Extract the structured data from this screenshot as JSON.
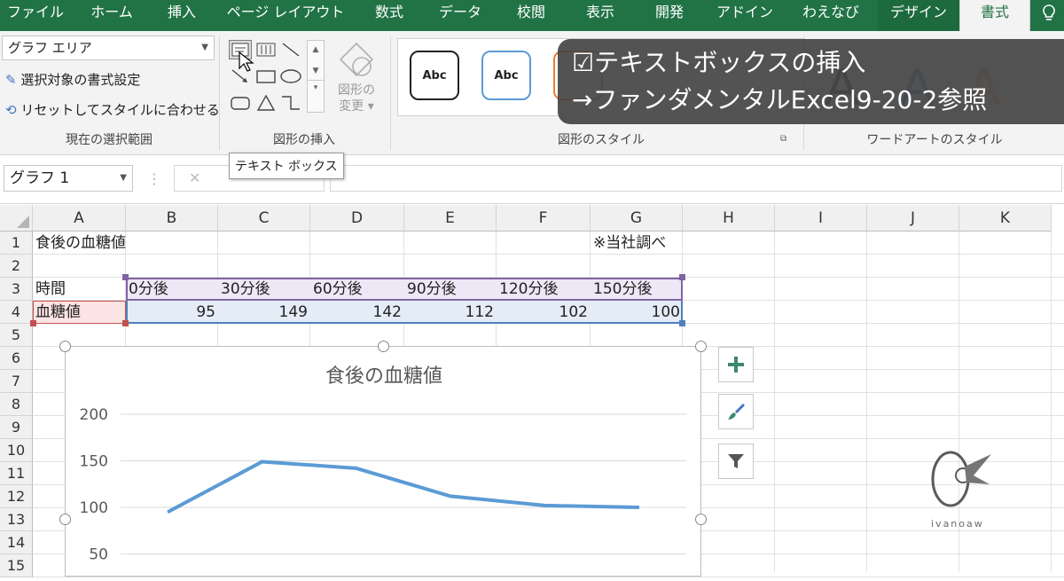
{
  "tabs": [
    "ファイル",
    "ホーム",
    "挿入",
    "ページ レイアウト",
    "数式",
    "データ",
    "校閲",
    "表示",
    "開発",
    "アドイン",
    "わえなび",
    "デザイン",
    "書式"
  ],
  "tab_lightbulb_icon": "lightbulb-icon",
  "ribbon": {
    "selection_combo": "グラフ エリア",
    "format_selection": "選択対象の書式設定",
    "reset_style": "リセットしてスタイルに合わせる",
    "group_current_selection": "現在の選択範囲",
    "change_shape_line1": "図形の",
    "change_shape_line2": "変更",
    "group_insert_shapes": "図形の挿入",
    "shape_style_abc1": "Abc",
    "shape_style_abc2": "Abc",
    "group_shape_styles": "図形のスタイル",
    "group_wordart_styles": "ワードアートのスタイル",
    "tooltip": "テキスト ボックス"
  },
  "formula_bar": {
    "name_box": "グラフ 1",
    "cancel_symbol": "✕"
  },
  "caption": {
    "line1": "☑テキストボックスの挿入",
    "line2": "→ファンダメンタルExcel9-20-2参照"
  },
  "columns": [
    "A",
    "B",
    "C",
    "D",
    "E",
    "F",
    "G",
    "H",
    "I",
    "J",
    "K"
  ],
  "rows": [
    "1",
    "2",
    "3",
    "4",
    "5",
    "6",
    "7",
    "8",
    "9",
    "10",
    "11",
    "12",
    "13",
    "14",
    "15"
  ],
  "cells": {
    "A1": "食後の血糖値",
    "G1": "※当社調べ",
    "A3": "時間",
    "B3": "0分後",
    "C3": "30分後",
    "D3": "60分後",
    "E3": "90分後",
    "F3": "120分後",
    "G3": "150分後",
    "A4": "血糖値",
    "B4": "95",
    "C4": "149",
    "D4": "142",
    "E4": "112",
    "F4": "102",
    "G4": "100"
  },
  "chart_data": {
    "type": "line",
    "title": "食後の血糖値",
    "categories": [
      "0分後",
      "30分後",
      "60分後",
      "90分後",
      "120分後",
      "150分後"
    ],
    "values": [
      95,
      149,
      142,
      112,
      102,
      100
    ],
    "yticks": [
      "200",
      "150",
      "100",
      "50"
    ],
    "ylim": [
      0,
      200
    ],
    "line_color": "#5b9bd5",
    "grid": true
  },
  "chart_buttons": [
    "plus-icon",
    "brush-icon",
    "filter-icon"
  ],
  "watermark": "ivanoaw"
}
